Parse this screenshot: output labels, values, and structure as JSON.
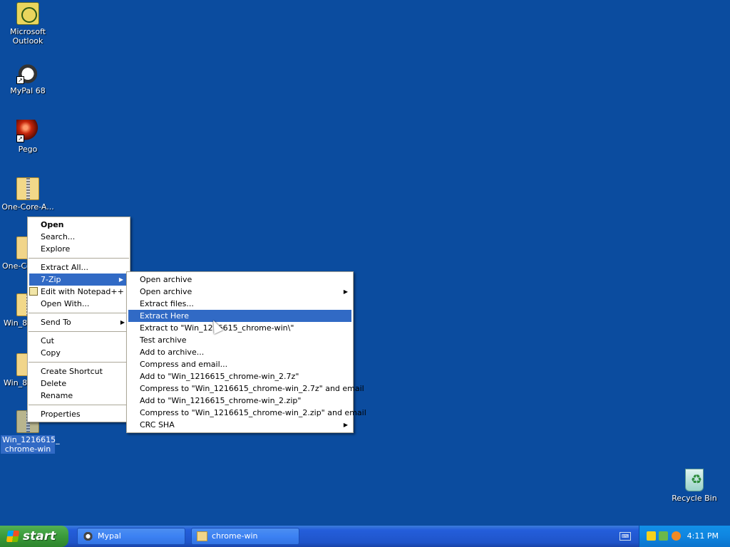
{
  "desktop": {
    "icons": [
      {
        "label": "Microsoft Outlook"
      },
      {
        "label": "MyPal 68"
      },
      {
        "label": "Pego"
      },
      {
        "label": "One-Core-A..."
      },
      {
        "label": "One-Co"
      },
      {
        "label": "Win_89"
      },
      {
        "label": "Win_89"
      },
      {
        "label": "Win_1216615_ chrome-win"
      },
      {
        "label": "Recycle Bin"
      }
    ]
  },
  "context_menu": {
    "items": [
      "Open",
      "Search...",
      "Explore",
      "Extract All...",
      "7-Zip",
      "Edit with Notepad++",
      "Open With...",
      "Send To",
      "Cut",
      "Copy",
      "Create Shortcut",
      "Delete",
      "Rename",
      "Properties"
    ]
  },
  "zip_submenu": {
    "items": [
      "Open archive",
      "Open archive",
      "Extract files...",
      "Extract Here",
      "Extract to \"Win_1216615_chrome-win\\\"",
      "Test archive",
      "Add to archive...",
      "Compress and email...",
      "Add to \"Win_1216615_chrome-win_2.7z\"",
      "Compress to \"Win_1216615_chrome-win_2.7z\" and email",
      "Add to \"Win_1216615_chrome-win_2.zip\"",
      "Compress to \"Win_1216615_chrome-win_2.zip\" and email",
      "CRC SHA"
    ]
  },
  "taskbar": {
    "start": "start",
    "tasks": [
      "Mypal",
      "chrome-win"
    ],
    "clock": "4:11 PM"
  },
  "colors": {
    "desktop": "#0B4C9F",
    "highlight": "#316AC5",
    "taskbar": "#245EDB"
  },
  "icons": [
    "outlook-icon",
    "raccoon-icon",
    "pego-icon",
    "zip-folder-icon",
    "folder-icon",
    "recycle-bin-icon",
    "notepad-icon",
    "keyboard-icon",
    "shield-icon",
    "search-icon"
  ]
}
